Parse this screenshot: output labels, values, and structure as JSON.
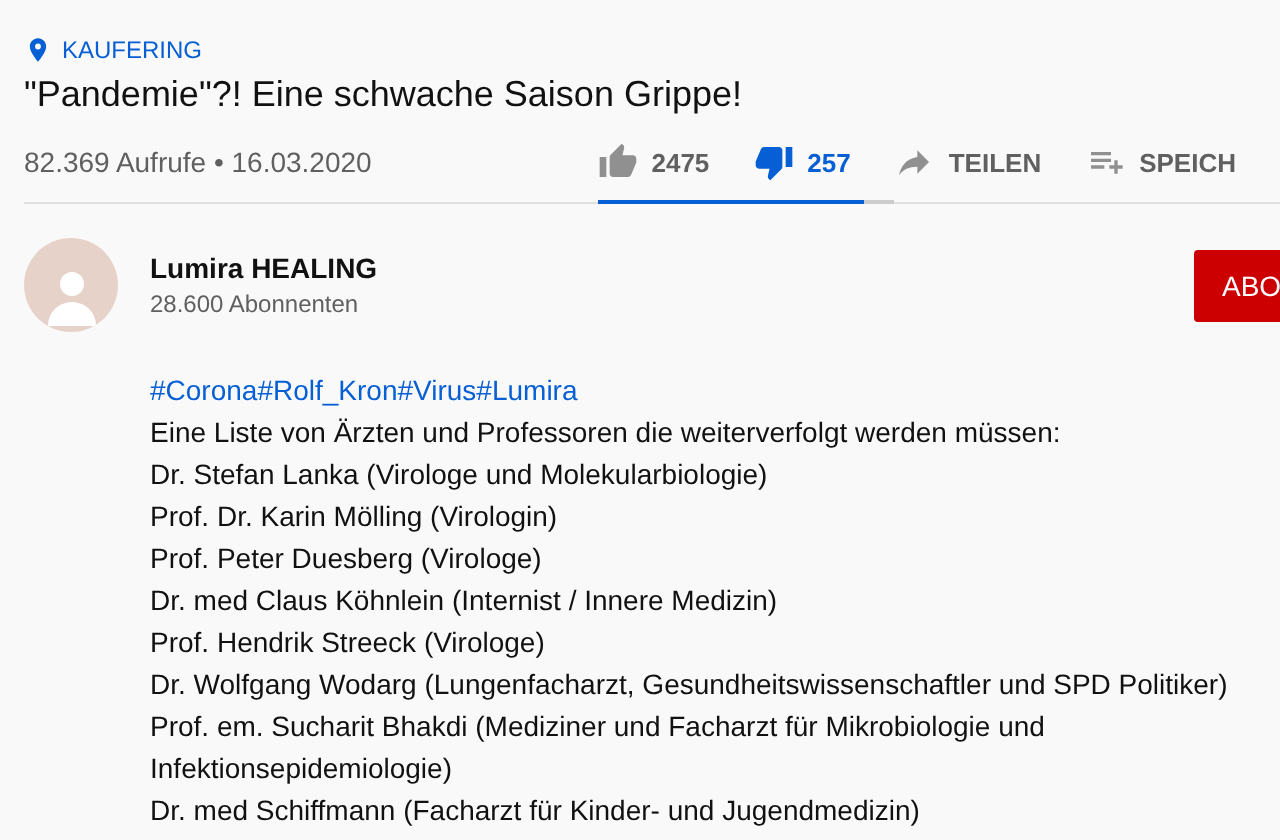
{
  "video": {
    "location": "KAUFERING",
    "title": "\"Pandemie\"?! Eine schwache Saison Grippe!",
    "views": "82.369 Aufrufe • 16.03.2020"
  },
  "actions": [
    {
      "kind": "like",
      "label": "2475",
      "selected": false
    },
    {
      "kind": "dislike",
      "label": "257",
      "selected": true
    },
    {
      "kind": "share",
      "label": "TEILEN",
      "selected": false
    },
    {
      "kind": "save",
      "label": "SPEICH",
      "selected": false
    }
  ],
  "sentiment_bar": {
    "level": 0.9
  },
  "channel": {
    "name": "Lumira HEALING",
    "subscribers": "28.600 Abonnenten",
    "subscribe_button": "ABO"
  },
  "description": {
    "hashtags": "#Corona#Rolf_Kron#Virus#Lumira",
    "lines": [
      "Eine Liste von Ärzten und Professoren die weiterverfolgt werden müssen:",
      "Dr. Stefan Lanka (Virologe und Molekularbiologie)",
      "Prof. Dr. Karin Mölling (Virologin)",
      "Prof. Peter Duesberg (Virologe)",
      "Dr. med Claus Köhnlein (Internist / Innere Medizin)",
      "Prof. Hendrik Streeck (Virologe)",
      "Dr. Wolfgang Wodarg (Lungenfacharzt, Gesundheitswissenschaftler und SPD Politiker)",
      "Prof. em. Sucharit Bhakdi (Mediziner und Facharzt für Mikrobiologie und Infektionsepidemiologie)",
      "Dr. med Schiffmann (Facharzt für Kinder- und Jugendmedizin)"
    ]
  }
}
